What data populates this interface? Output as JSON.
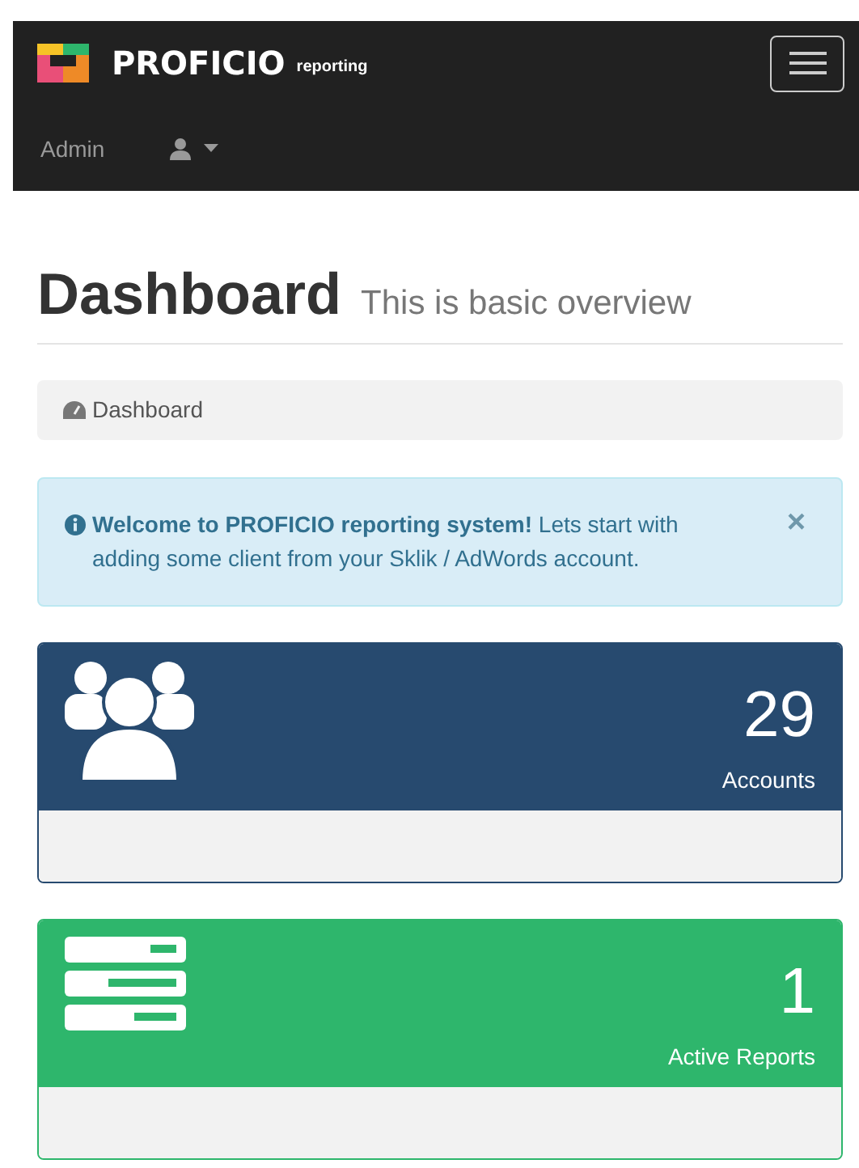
{
  "navbar": {
    "brand": "PROFICIO",
    "brand_sub": "reporting",
    "user_label": "Admin"
  },
  "header": {
    "title": "Dashboard",
    "subtitle": "This is basic overview"
  },
  "breadcrumb": {
    "label": "Dashboard"
  },
  "alert": {
    "text": "**Welcome to PROFICIO reporting system!** Lets start with adding some client from your Sklik / AdWords account.",
    "close": "×"
  },
  "cards": [
    {
      "kind": "users",
      "color": "#274a6f",
      "value": "29",
      "label": "Accounts"
    },
    {
      "kind": "list",
      "color": "#2eb66c",
      "value": "1",
      "label": "Active Reports"
    }
  ]
}
